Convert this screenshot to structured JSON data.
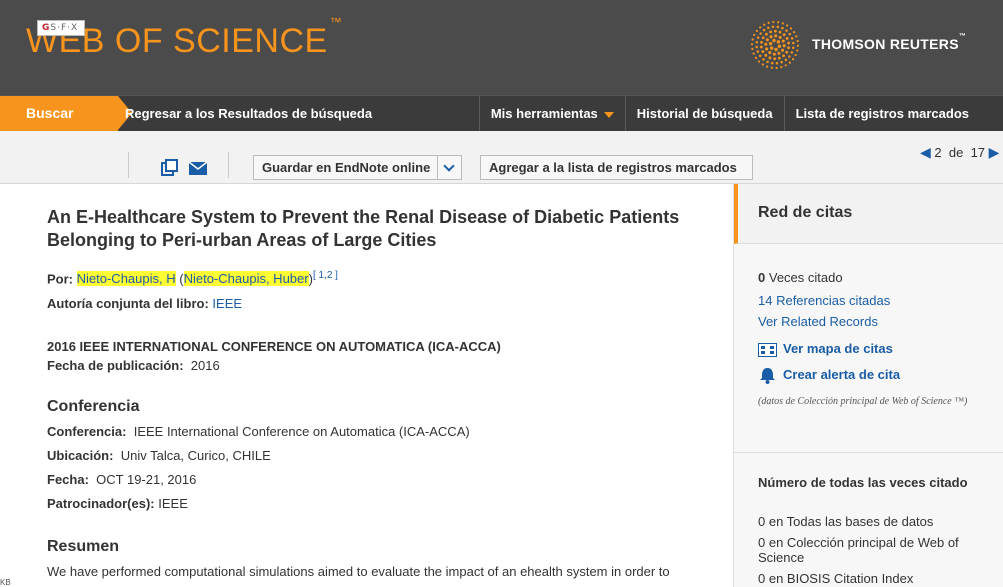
{
  "header": {
    "logo": "WEB OF SCIENCE",
    "logo_tm": "™",
    "brand": "THOMSON REUTERS",
    "brand_tm": "™"
  },
  "nav": {
    "search": "Buscar",
    "back": "Regresar a los Resultados de búsqueda",
    "tools": "Mis herramientas",
    "history": "Historial de búsqueda",
    "marked": "Lista de registros marcados"
  },
  "toolbar": {
    "sfx": "S·F·X",
    "save_endnote": "Guardar en EndNote online",
    "add_marked": "Agregar a la lista de registros marcados",
    "pager_current": "2",
    "pager_of": "de",
    "pager_total": "17"
  },
  "record": {
    "title": "An E-Healthcare System to Prevent the Renal Disease of Diabetic Patients Belonging to Peri-urban Areas of Large Cities",
    "by_label": "Por:",
    "author_short": "Nieto-Chaupis, H",
    "author_full": "Nieto-Chaupis, Huber",
    "author_refs": "[ 1,2 ]",
    "book_author_label": "Autoría conjunta del libro:",
    "book_author": "IEEE",
    "source": "2016 IEEE INTERNATIONAL CONFERENCE ON AUTOMATICA (ICA-ACCA)",
    "pubdate_label": "Fecha de publicación:",
    "pubdate": "2016",
    "conference_heading": "Conferencia",
    "conference_label": "Conferencia:",
    "conference": "IEEE International Conference on Automatica (ICA-ACCA)",
    "location_label": "Ubicación:",
    "location": "Univ Talca, Curico, CHILE",
    "date_label": "Fecha:",
    "date": "OCT 19-21, 2016",
    "sponsor_label": "Patrocinador(es):",
    "sponsor": "IEEE",
    "abstract_heading": "Resumen",
    "abstract": "We have performed computational simulations aimed to evaluate the impact of an ehealth system in order to"
  },
  "sidebar": {
    "heading": "Red de citas",
    "times_cited_count": "0",
    "times_cited_label": "Veces citado",
    "references": "14 Referencias citadas",
    "related": "Ver Related Records",
    "citation_map": "Ver mapa de citas",
    "citation_alert": "Crear alerta de cita",
    "note": "(datos de Colección principal de Web of Science ™)",
    "all_times_heading": "Número de todas las veces citado",
    "all_db": "0 en Todas las bases de datos",
    "core": "0 en Colección principal de Web of Science",
    "biosis": "0 en BIOSIS Citation Index"
  },
  "colors": {
    "accent": "#f7941d",
    "header_bg": "#4b4b4b",
    "link": "#1a5da6",
    "highlight": "#ffff33"
  },
  "status": "KB"
}
